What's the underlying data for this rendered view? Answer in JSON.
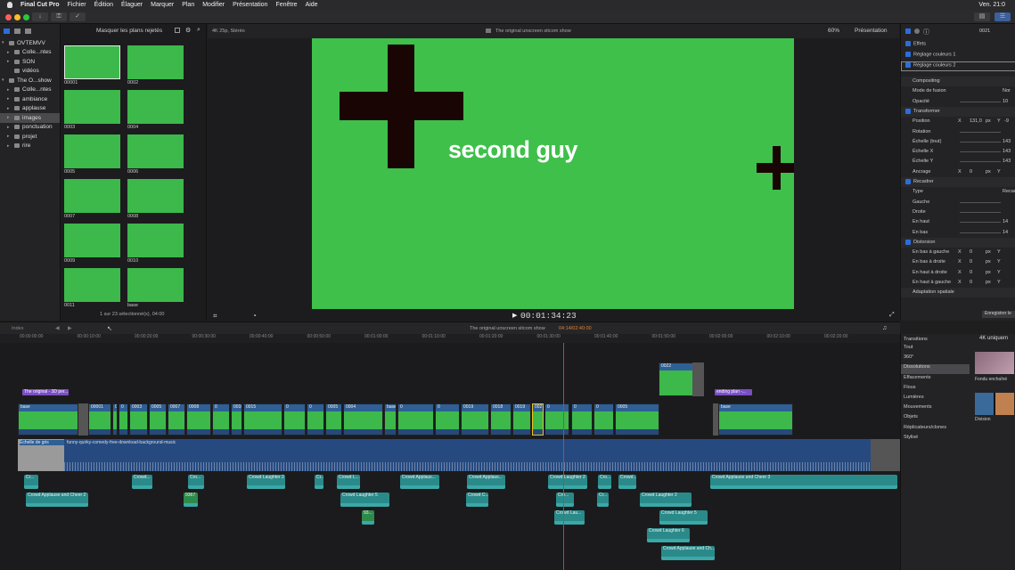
{
  "menubar": {
    "apple": "",
    "app": "Final Cut Pro",
    "items": [
      "Fichier",
      "Édition",
      "Élaguer",
      "Marquer",
      "Plan",
      "Modifier",
      "Présentation",
      "Fenêtre",
      "Aide"
    ],
    "clock": "Ven. 21:0"
  },
  "libraries": [
    {
      "label": "OVTEMVV",
      "level": 0,
      "arrow": "▾"
    },
    {
      "label": "Colle...ntes",
      "level": 1,
      "arrow": "▸"
    },
    {
      "label": "SON",
      "level": 1,
      "arrow": "▸"
    },
    {
      "label": "vidéos",
      "level": 1,
      "arrow": ""
    },
    {
      "label": "The O...show",
      "level": 0,
      "arrow": "▾"
    },
    {
      "label": "Colle...ntes",
      "level": 1,
      "arrow": "▸"
    },
    {
      "label": "ambiance",
      "level": 1,
      "arrow": "▸"
    },
    {
      "label": "applause",
      "level": 1,
      "arrow": "▸"
    },
    {
      "label": "images",
      "level": 1,
      "arrow": "▸",
      "selected": true
    },
    {
      "label": "ponctuation",
      "level": 1,
      "arrow": "▸"
    },
    {
      "label": "projet",
      "level": 1,
      "arrow": "▸"
    },
    {
      "label": "rire",
      "level": 1,
      "arrow": "▸"
    }
  ],
  "browser": {
    "filter": "Masquer les plans rejetés",
    "status": "1 sur 23 sélectionné(s), 04:00",
    "thumbs": [
      "00001",
      "0002",
      "0003",
      "0004",
      "0005",
      "0006",
      "0007",
      "0008",
      "0009",
      "0010",
      "0011",
      "base"
    ]
  },
  "viewer": {
    "format": "4K 25p, Stéréo",
    "title": "The original unscreen sitcom show",
    "zoom": "60%",
    "view": "Présentation",
    "overlay_text": "second guy",
    "timecode": "00:01:34:23"
  },
  "inspector": {
    "clip_id": "0021",
    "effects": {
      "header": "Effets",
      "items": [
        "Réglage couleurs 1",
        "Réglage couleurs 2"
      ]
    },
    "rows": [
      {
        "label": "Compositing",
        "bold": true
      },
      {
        "label": "Mode de fusion",
        "value": "Nor"
      },
      {
        "label": "Opacité",
        "value": "10"
      },
      {
        "label": "Transformer",
        "check": true,
        "bold": true
      },
      {
        "label": "Position",
        "x": "X",
        "xval": "131,0",
        "unit": "px",
        "y": "Y",
        "yval": "-9"
      },
      {
        "label": "Rotation"
      },
      {
        "label": "Échelle (tout)",
        "value": "143"
      },
      {
        "label": "Échelle X",
        "value": "143"
      },
      {
        "label": "Échelle Y",
        "value": "143"
      },
      {
        "label": "Ancrage",
        "x": "X",
        "xval": "0",
        "unit": "px",
        "y": "Y"
      },
      {
        "label": "Recadrer",
        "check": true,
        "bold": true
      },
      {
        "label": "Type",
        "value": "Recad"
      },
      {
        "label": "Gauche"
      },
      {
        "label": "Droite"
      },
      {
        "label": "En haut",
        "value": "14"
      },
      {
        "label": "En bas",
        "value": "14"
      },
      {
        "label": "Distorsion",
        "check": true,
        "bold": true
      },
      {
        "label": "En bas à gauche",
        "x": "X",
        "xval": "0",
        "unit": "px",
        "y": "Y"
      },
      {
        "label": "En bas à droite",
        "x": "X",
        "xval": "0",
        "unit": "px",
        "y": "Y"
      },
      {
        "label": "En haut à droite",
        "x": "X",
        "xval": "0",
        "unit": "px",
        "y": "Y"
      },
      {
        "label": "En haut à gauche",
        "x": "X",
        "xval": "0",
        "unit": "px",
        "y": "Y"
      },
      {
        "label": "Adaptation spatiale",
        "bold": true
      }
    ],
    "save": "Enregistrer le"
  },
  "timeline": {
    "index": "Index",
    "project": "The original unscreen sitcom show",
    "duration": "04:14/02:40:00",
    "ruler": [
      "00:00:00:00",
      "00:00:10:00",
      "00:00:20:00",
      "00:00:30:00",
      "00:00:40:00",
      "00:00:50:00",
      "00:01:00:00",
      "00:01:10:00",
      "00:01:20:00",
      "00:01:30:00",
      "00:01:40:00",
      "00:01:50:00",
      "00:02:00:00",
      "00:02:10:00",
      "00:02:20:00"
    ],
    "titles": [
      "The original - 3D per...",
      "ending plan -..."
    ],
    "video_clips": [
      "base",
      "00001",
      "0",
      "0",
      "0003",
      "0005",
      "0007",
      "0008",
      "0",
      "0010",
      "0015",
      "0",
      "0",
      "0005",
      "0004",
      "base",
      "0",
      "0",
      "0019",
      "0018",
      "0019",
      "0021",
      "0",
      "0",
      "0",
      "0005",
      "base"
    ],
    "connected": "0022",
    "greyscale": "Échelle de gris",
    "music": "funny-quirky-comedy-free-download-background-music",
    "audio": [
      "Cr...",
      "Crowd...",
      "Cro...",
      "Crowd Laughter 2",
      "Cr...",
      "Crowd L...",
      "Crowd Applaus...",
      "Crowd Applaus...",
      "Crowd Laughter 2",
      "Cro...",
      "Crowd...",
      "Crowd Applause and Cheer 3",
      "Crowd Applause and Cheer 2",
      "9367",
      "Crowd Laughter 5",
      "Crowd C...",
      "Cro...",
      "Cr...",
      "Crowd Laughter 2",
      "93...",
      "Crowd Lau...",
      "Crowd Laughter 5",
      "Crowd Laughter 6",
      "Crowd Applause and Ch..."
    ]
  },
  "transitions": {
    "header": "Transitions",
    "resolution": "4K uniquem",
    "categories": [
      "Tout",
      "360°",
      "Dissolutions",
      "Effacements",
      "Flous",
      "Lumières",
      "Mouvements",
      "Objets",
      "Réplicateurs/clones",
      "Stylisé"
    ],
    "selected": "Dissolutions",
    "items": [
      "Fondu enchaîné",
      "Division"
    ]
  },
  "colors": {
    "green": "#3ec04a",
    "accent": "#2d6ddb",
    "playhead": "#e0342f",
    "title": "#7b4fc4",
    "audio": "#2a8a8a"
  }
}
